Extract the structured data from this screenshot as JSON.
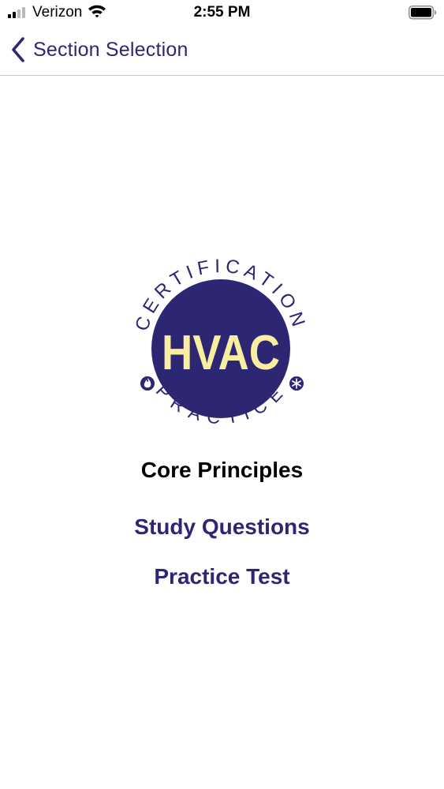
{
  "status_bar": {
    "carrier": "Verizon",
    "time": "2:55 PM",
    "signal_bars_active": 2,
    "signal_bars_total": 4,
    "battery_level": 0.95
  },
  "nav": {
    "back_label": "Section Selection"
  },
  "logo": {
    "top_text": "CERTIFICATION",
    "center_text": "HVAC",
    "bottom_text": "PRACTICE",
    "left_icon": "flame-icon",
    "right_icon": "snowflake-icon"
  },
  "content": {
    "section_title": "Core Principles",
    "study_questions": "Study Questions",
    "practice_test": "Practice Test"
  },
  "colors": {
    "brand_purple": "#2d2673",
    "logo_yellow": "#f8eea0",
    "background": "#ffffff"
  }
}
